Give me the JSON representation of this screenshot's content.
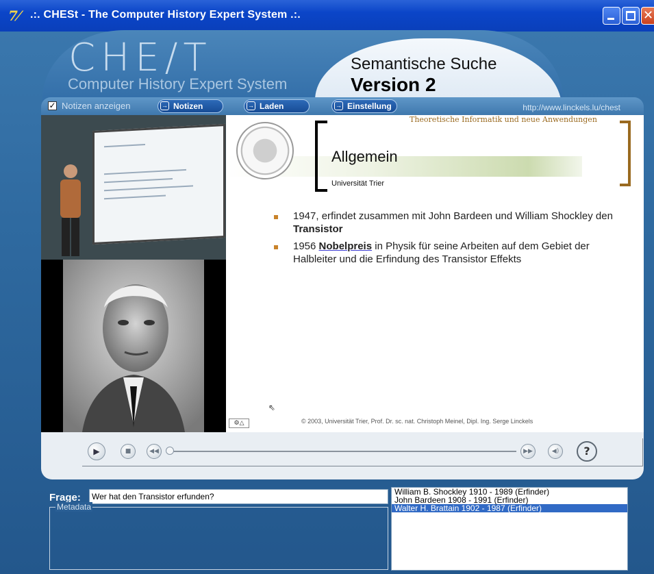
{
  "window": {
    "title": ".:. CHESt - The Computer History Expert System .:.",
    "icon": "app-icon"
  },
  "header": {
    "logo": "CHE/T",
    "logo_sub": "Computer History Expert System",
    "semantic": "Semantische Suche",
    "version": "Version 2"
  },
  "toolbar": {
    "notes_checkbox_label": "Notizen anzeigen",
    "notes_checked": true,
    "buttons": [
      "Notizen",
      "Laden",
      "Einstellung"
    ],
    "url": "http://www.linckels.lu/chest"
  },
  "slide": {
    "institute": "Theoretische Informatik und neue Anwendungen",
    "title": "Allgemein",
    "university": "Universität Trier",
    "bullets": [
      {
        "pre": "1947, erfindet zusammen mit John Bardeen und  William Shockley den ",
        "bold": "Transistor",
        "post": ""
      },
      {
        "pre": "1956 ",
        "bold": "Nobelpreis",
        "post": " in Physik für seine Arbeiten auf dem Gebiet der Halbleiter und die Erfindung des Transistor Effekts"
      }
    ],
    "footer": "© 2003, Universität Trier, Prof. Dr. sc. nat. Christoph Meinel, Dipl. Ing. Serge Linckels"
  },
  "form": {
    "frage_label": "Frage:",
    "frage_value": "Wer hat den Transistor erfunden?",
    "metadata_label": "Metadata",
    "results": [
      "William B. Shockley 1910 - 1989 (Erfinder)",
      "John Bardeen 1908 - 1991 (Erfinder)",
      "Walter H. Brattain 1902 - 1987 (Erfinder)"
    ],
    "selected_index": 2
  },
  "colors": {
    "accent": "#316ac5",
    "bullet": "#c9832a",
    "institute": "#9a6a20"
  }
}
